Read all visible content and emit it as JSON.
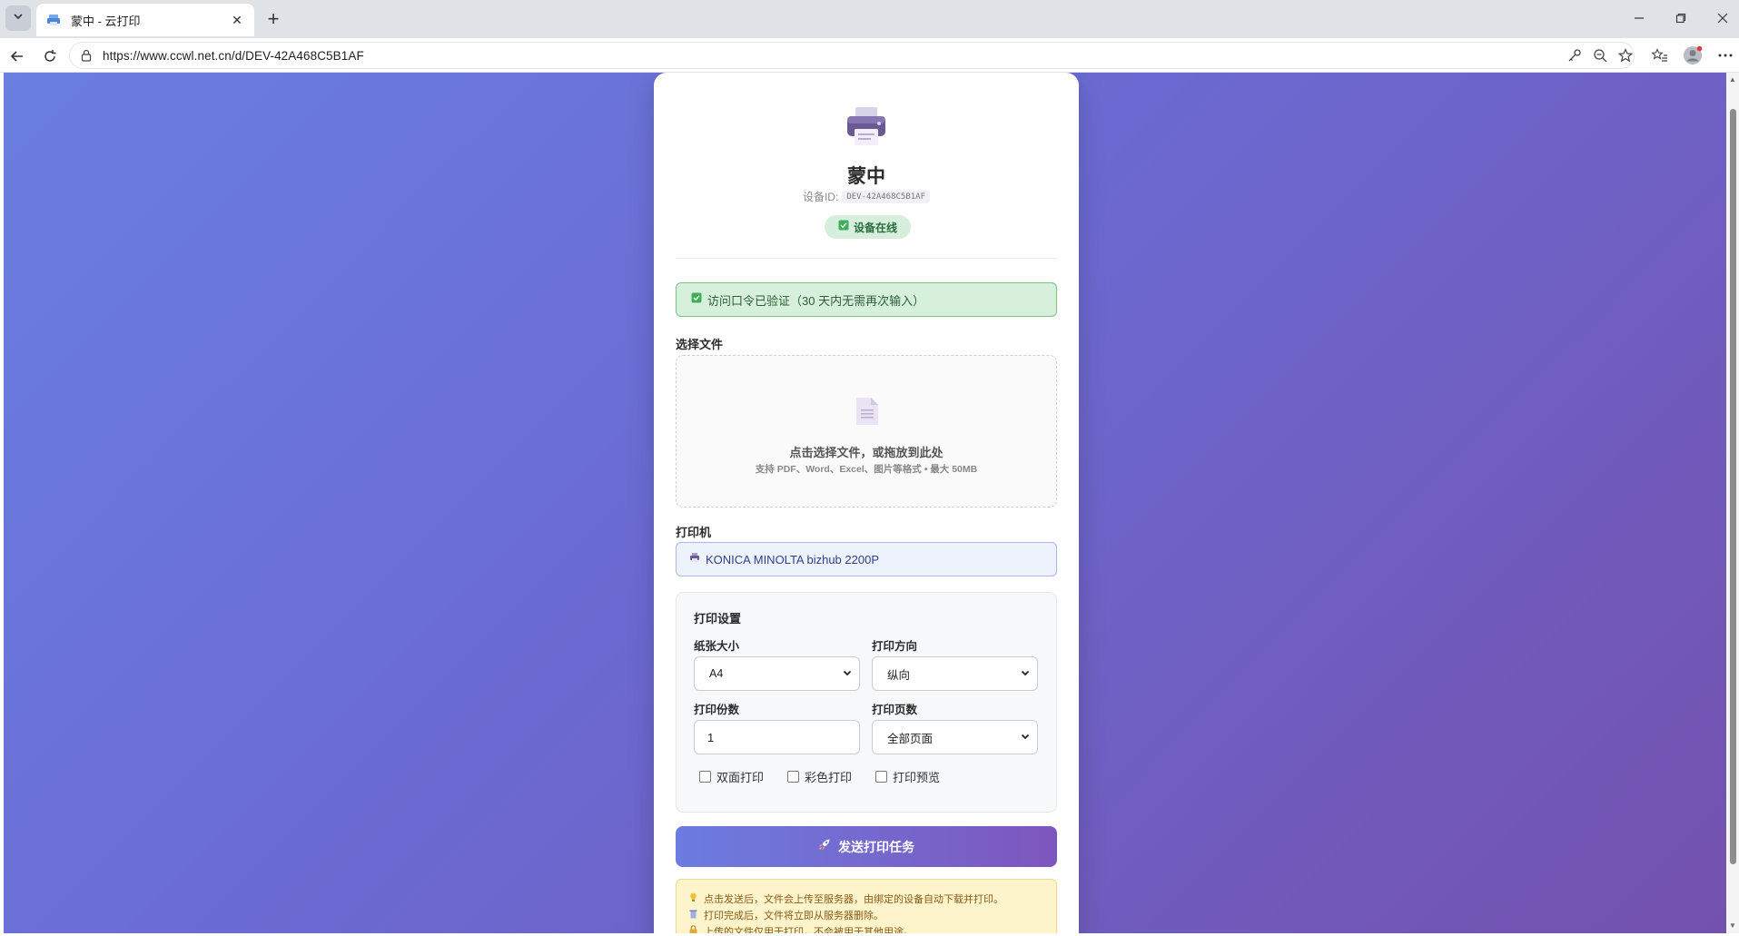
{
  "browser": {
    "tab_title": "蒙中 - 云打印",
    "url": "https://www.ccwl.net.cn/d/DEV-42A468C5B1AF"
  },
  "device": {
    "name": "蒙中",
    "id_label": "设备ID:",
    "id_value": "DEV-42A468C5B1AF",
    "status": "设备在线"
  },
  "auth": {
    "message": "访问口令已验证（30 天内无需再次输入）"
  },
  "file_section": {
    "label": "选择文件",
    "drop_main": "点击选择文件，或拖放到此处",
    "drop_sub": "支持 PDF、Word、Excel、图片等格式 • 最大 50MB"
  },
  "printer_section": {
    "label": "打印机",
    "printer_name": "KONICA MINOLTA bizhub 2200P"
  },
  "settings": {
    "title": "打印设置",
    "paper_size_label": "纸张大小",
    "paper_size_value": "A4",
    "orientation_label": "打印方向",
    "orientation_value": "纵向",
    "copies_label": "打印份数",
    "copies_value": "1",
    "pages_label": "打印页数",
    "pages_value": "全部页面",
    "duplex_label": "双面打印",
    "color_label": "彩色打印",
    "preview_label": "打印预览"
  },
  "submit": {
    "label": "发送打印任务"
  },
  "notices": [
    "点击发送后，文件会上传至服务器，由绑定的设备自动下载并打印。",
    "打印完成后，文件将立即从服务器删除。",
    "上传的文件仅用于打印，不会被用于其他用途。"
  ],
  "colors": {
    "accent_start": "#6a7fe0",
    "accent_end": "#7451ae",
    "success": "#2c6b3d",
    "warning": "#8a5a14"
  }
}
